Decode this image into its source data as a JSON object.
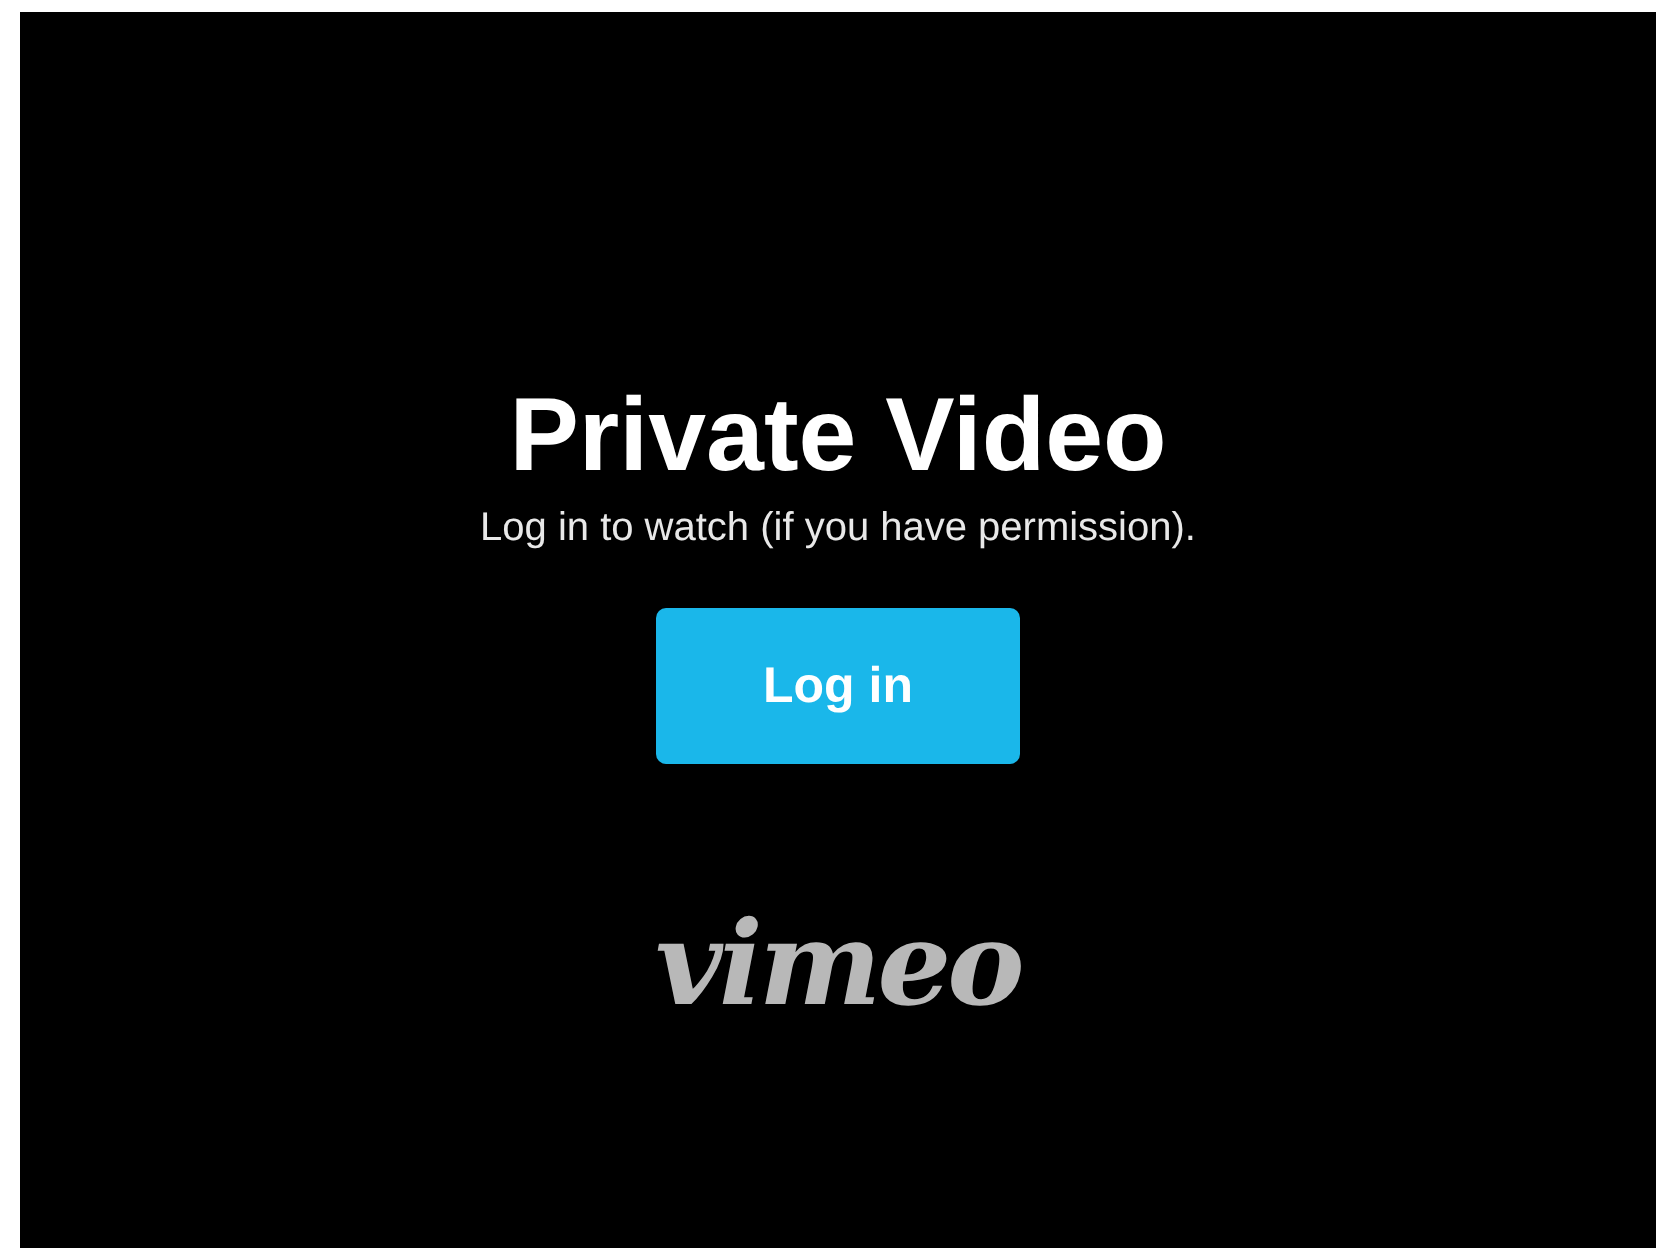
{
  "title": "Private Video",
  "message": "Log in to watch (if you have permission).",
  "login_button": {
    "label": "Log in"
  },
  "logo": "vimeo"
}
